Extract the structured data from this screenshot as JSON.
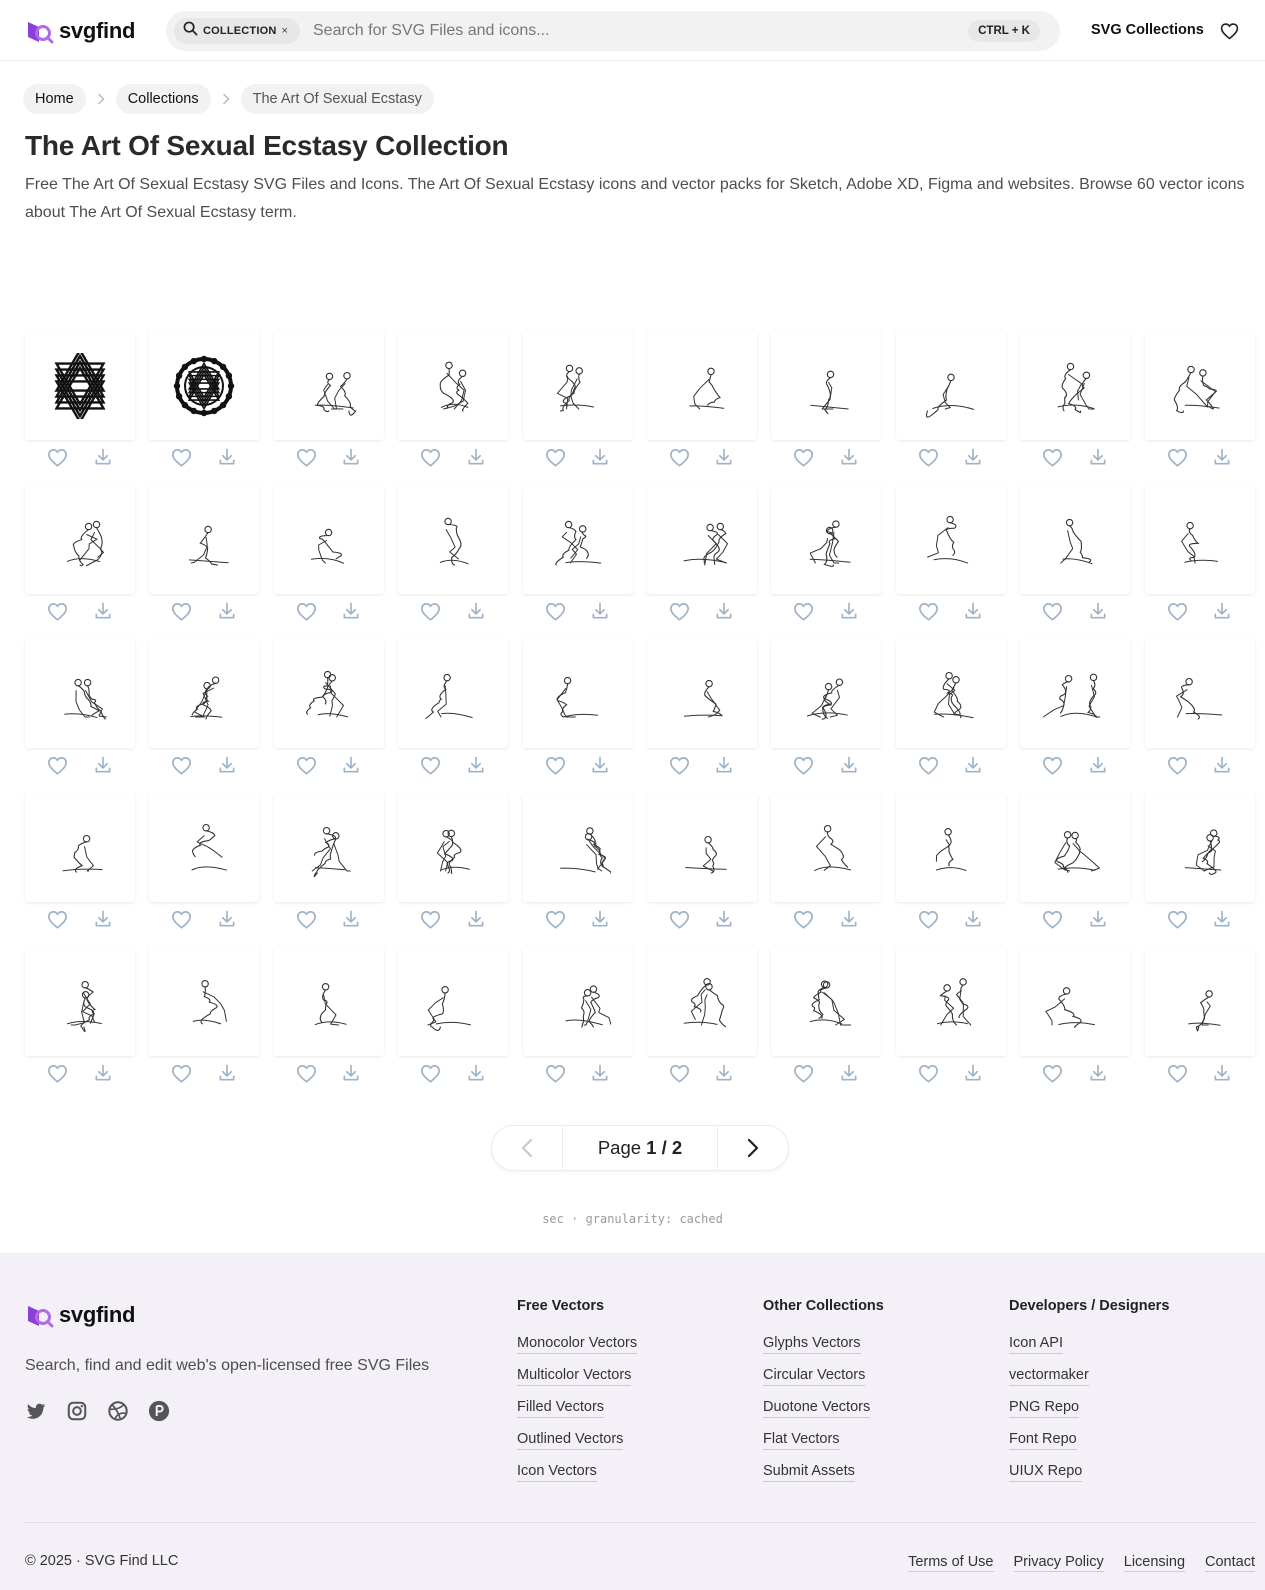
{
  "header": {
    "logo_text": "svgfind",
    "search_pill": "COLLECTION",
    "search_pill_close": "×",
    "search_placeholder": "Search for SVG Files and icons...",
    "shortcut": "CTRL + K",
    "nav_collections": "SVG Collections"
  },
  "breadcrumb": [
    "Home",
    "Collections",
    "The Art Of Sexual Ecstasy"
  ],
  "page": {
    "title": "The Art Of Sexual Ecstasy Collection",
    "description": "Free The Art Of Sexual Ecstasy SVG Files and Icons. The Art Of Sexual Ecstasy icons and vector packs for Sketch, Adobe XD, Figma and websites. Browse 60 vector icons about The Art Of Sexual Ecstasy term."
  },
  "icons": {
    "count_visible": 50,
    "kinds": [
      "sri-yantra-icon",
      "sri-yantra-circle-icon",
      "figure-sketch-icon"
    ]
  },
  "pagination": {
    "page_word": "Page",
    "current": "1",
    "separator": "/",
    "total": "2"
  },
  "granularity_text": "sec · granularity: cached",
  "footer": {
    "logo_text": "svgfind",
    "tagline": "Search, find and edit web's open-licensed free SVG Files",
    "socials": [
      "twitter-icon",
      "instagram-icon",
      "dribbble-icon",
      "producthunt-icon"
    ],
    "columns": [
      {
        "title": "Free Vectors",
        "links": [
          "Monocolor Vectors",
          "Multicolor Vectors",
          "Filled Vectors",
          "Outlined Vectors",
          "Icon Vectors"
        ]
      },
      {
        "title": "Other Collections",
        "links": [
          "Glyphs Vectors",
          "Circular Vectors",
          "Duotone Vectors",
          "Flat Vectors",
          "Submit Assets"
        ]
      },
      {
        "title": "Developers / Designers",
        "links": [
          "Icon API",
          "vectormaker",
          "PNG Repo",
          "Font Repo",
          "UIUX Repo"
        ]
      }
    ],
    "copyright": "© 2025 · SVG Find LLC",
    "legal": [
      "Terms of Use",
      "Privacy Policy",
      "Licensing",
      "Contact"
    ]
  },
  "colors": {
    "brand_purple": "#8b3fd9",
    "action_icon": "#9fb3c8",
    "footer_bg": "#f4f0f7"
  }
}
